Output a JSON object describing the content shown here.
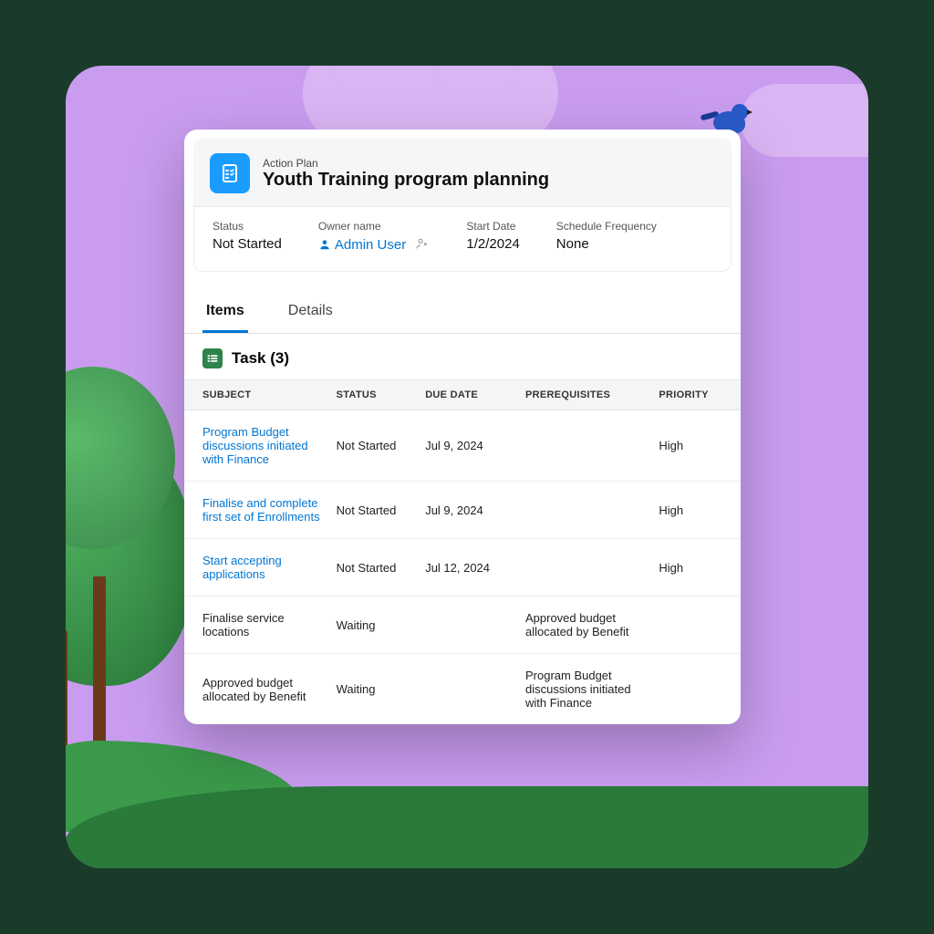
{
  "header": {
    "label": "Action Plan",
    "title": "Youth Training program planning"
  },
  "summary": {
    "status_label": "Status",
    "status_value": "Not Started",
    "owner_label": "Owner name",
    "owner_value": "Admin User",
    "start_label": "Start Date",
    "start_value": "1/2/2024",
    "freq_label": "Schedule Frequency",
    "freq_value": "None"
  },
  "tabs": {
    "items": "Items",
    "details": "Details"
  },
  "task_section": {
    "title": "Task (3)"
  },
  "columns": {
    "subject": "SUBJECT",
    "status": "STATUS",
    "due": "DUE DATE",
    "prereq": "PREREQUISITES",
    "priority": "PRIORITY"
  },
  "rows": [
    {
      "subject": "Program Budget discussions initiated with Finance",
      "status": "Not Started",
      "due": "Jul 9, 2024",
      "prereq": "",
      "priority": "High",
      "link": true
    },
    {
      "subject": "Finalise and complete first set of Enrollments",
      "status": "Not Started",
      "due": "Jul 9, 2024",
      "prereq": "",
      "priority": "High",
      "link": true
    },
    {
      "subject": "Start accepting applications",
      "status": "Not Started",
      "due": "Jul 12, 2024",
      "prereq": "",
      "priority": "High",
      "link": true
    },
    {
      "subject": "Finalise service locations",
      "status": "Waiting",
      "due": "",
      "prereq": "Approved budget allocated by Benefit",
      "priority": "",
      "link": false
    },
    {
      "subject": "Approved budget allocated by Benefit",
      "status": "Waiting",
      "due": "",
      "prereq": "Program Budget discussions initiated with Finance",
      "priority": "",
      "link": false
    }
  ]
}
